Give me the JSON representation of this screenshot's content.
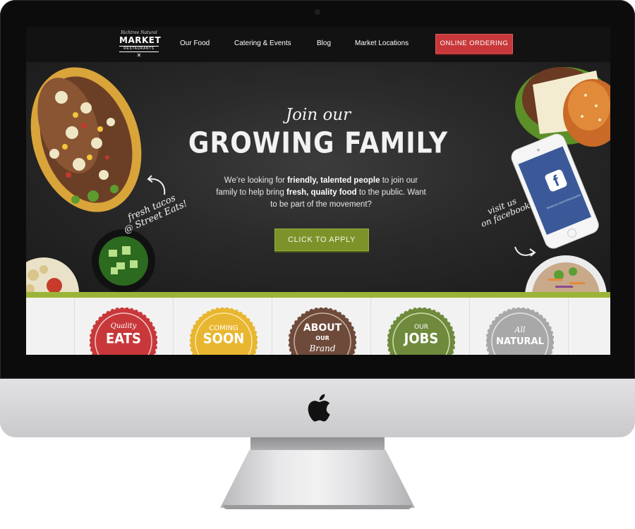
{
  "nav": {
    "logo_line1": "Richtree Natural",
    "logo_line2": "MARKET",
    "logo_line3": "RESTAURANTS",
    "links": [
      "Our Food",
      "Catering & Events",
      "Blog",
      "Market Locations"
    ],
    "order_button": "ONLINE ORDERING"
  },
  "hero": {
    "script_title": "Join our",
    "title": "GROWING FAMILY",
    "body_1": "We’re looking for ",
    "body_bold_1": "friendly, talented people",
    "body_2": " to join our family to help bring ",
    "body_bold_2": "fresh, quality food",
    "body_3": " to the public. Want to be part of the movement?",
    "apply_button": "CLICK TO APPLY",
    "note_left_1": "fresh tacos",
    "note_left_2": "@ Street Eats!",
    "note_right_1": "visit us",
    "note_right_2": "on facebook",
    "phone_caption": "facebook.com/richtreemarket"
  },
  "badges": [
    {
      "small": "Quality",
      "big": "EATS",
      "color": "#c8383a"
    },
    {
      "small": "COMING",
      "big": "SOON",
      "color": "#e8b630"
    },
    {
      "small": "ABOUT",
      "mid": "OUR",
      "big": "Brand",
      "color": "#6e4a3a"
    },
    {
      "small": "OUR",
      "big": "JOBS",
      "color": "#6f8a3c"
    },
    {
      "small": "All",
      "big": "NATURAL",
      "color": "#a8a8a8"
    }
  ],
  "colors": {
    "accent_red": "#c8383a",
    "accent_green": "#7c932a",
    "bar_green": "#9bb437",
    "facebook_blue": "#3b5998"
  },
  "icons": {
    "brand": "apple-icon",
    "social": "facebook-icon"
  }
}
